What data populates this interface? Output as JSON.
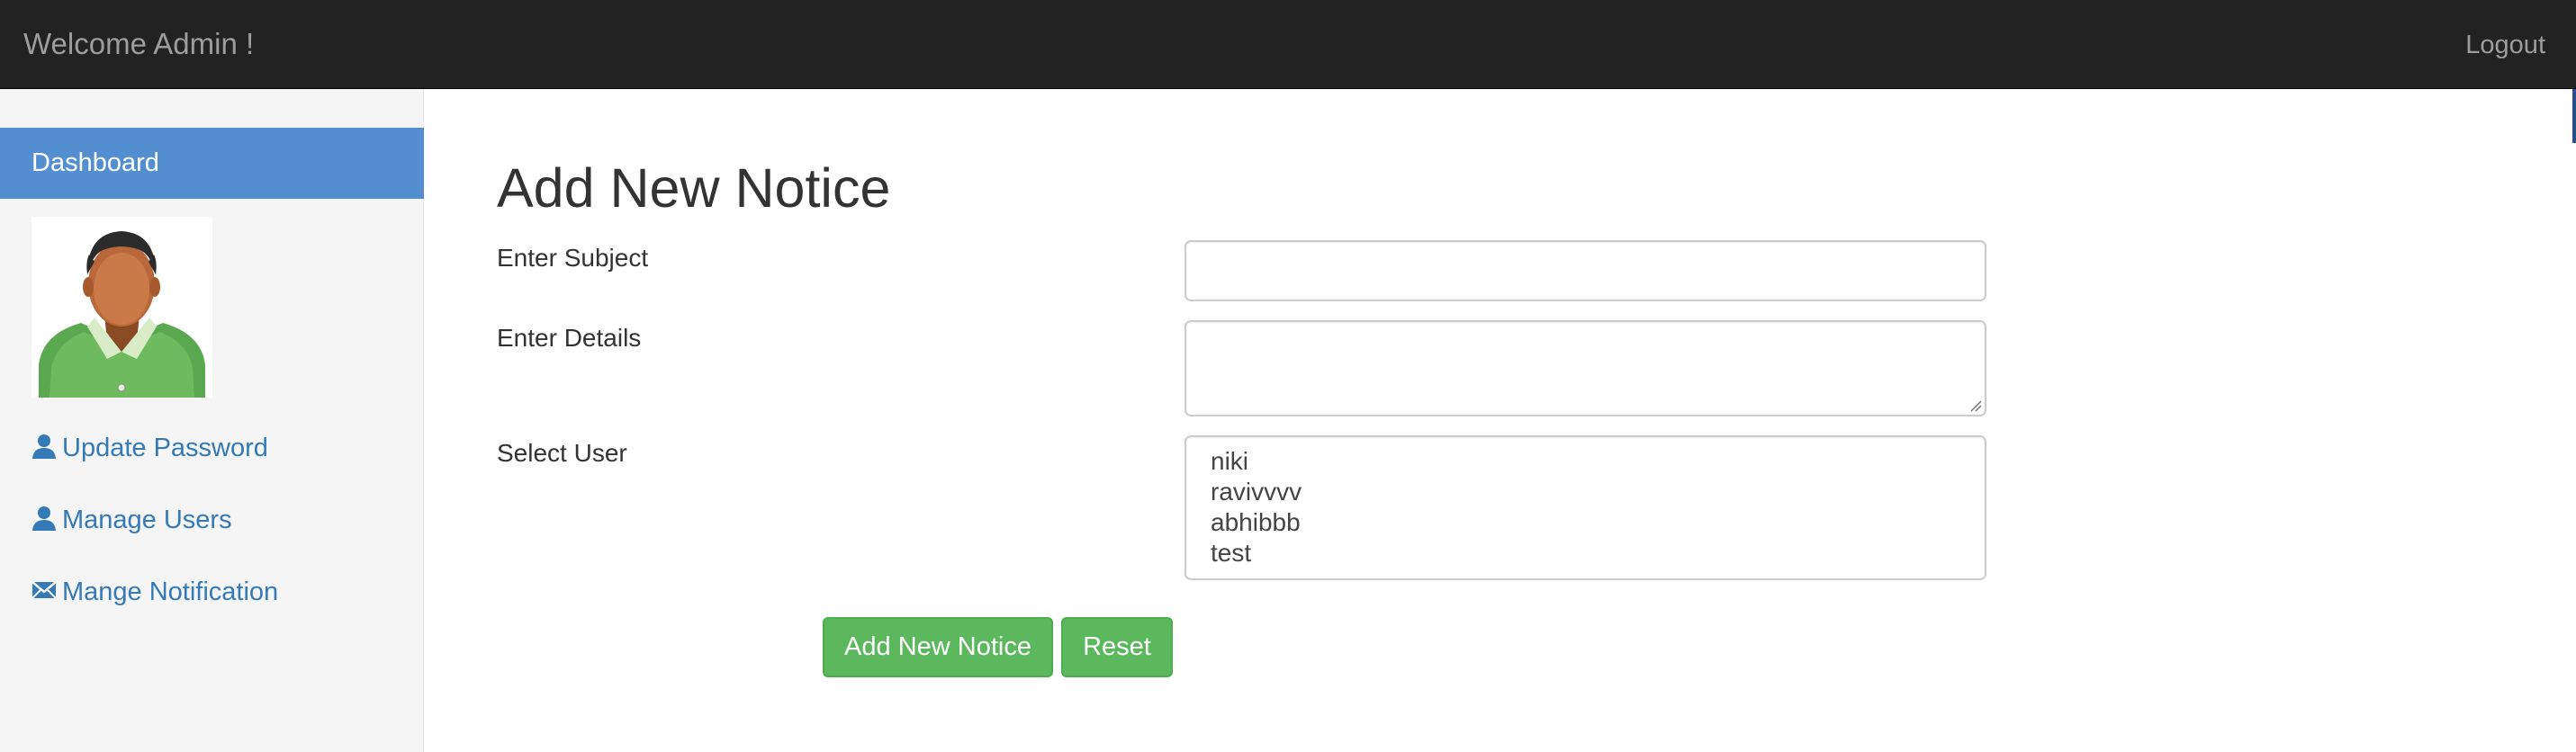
{
  "header": {
    "brand": "Welcome Admin !",
    "logout_label": "Logout"
  },
  "sidebar": {
    "dashboard_label": "Dashboard",
    "avatar_icon": "user-avatar-icon",
    "links": [
      {
        "label": "Update Password",
        "icon": "user-icon"
      },
      {
        "label": "Manage Users",
        "icon": "user-icon"
      },
      {
        "label": "Mange Notification",
        "icon": "envelope-icon"
      }
    ]
  },
  "form": {
    "title": "Add New Notice",
    "subject_label": "Enter Subject",
    "subject_value": "",
    "details_label": "Enter Details",
    "details_value": "",
    "user_label": "Select User",
    "user_options": [
      "niki",
      "ravivvvv",
      "abhibbb",
      "test"
    ],
    "submit_label": "Add New Notice",
    "reset_label": "Reset"
  },
  "colors": {
    "topbar": "#222222",
    "sidebar_active": "#538fd0",
    "link": "#337ab7",
    "button_success": "#5cb85c"
  }
}
